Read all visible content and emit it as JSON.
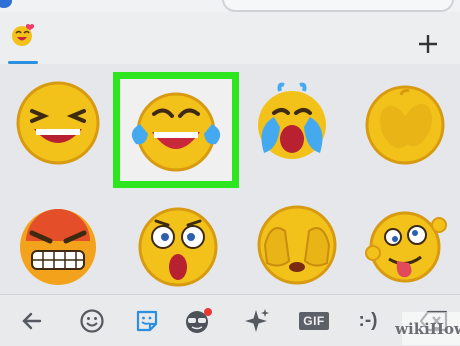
{
  "pack_bar": {
    "active_pack_icon": "laughing-heart-emoji-icon",
    "add_icon": "plus-icon"
  },
  "stickers": {
    "selected_index": 1,
    "items": [
      {
        "icon": "grinning-squint-emoji-sticker"
      },
      {
        "icon": "tears-of-joy-emoji-sticker"
      },
      {
        "icon": "loudly-crying-emoji-sticker"
      },
      {
        "icon": "shy-peeking-emoji-sticker"
      },
      {
        "icon": "angry-grimace-emoji-sticker"
      },
      {
        "icon": "shocked-emoji-sticker"
      },
      {
        "icon": "face-palm-emoji-sticker"
      },
      {
        "icon": "silly-tongue-out-emoji-sticker"
      }
    ]
  },
  "bottom_bar": {
    "gif_label": "GIF",
    "emoticon_label": ":-)",
    "active_item": "sticker-icon"
  },
  "watermark": {
    "text": "wikiHow"
  },
  "colors": {
    "selection_outline": "#2ee61f",
    "accent": "#2d8fe0",
    "emoji_yellow": "#f2c21b",
    "mouth_red": "#d93a3a"
  }
}
